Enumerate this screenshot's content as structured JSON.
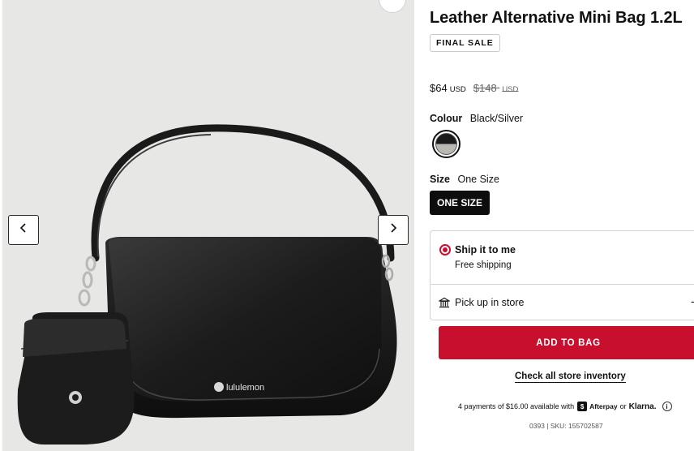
{
  "product": {
    "title": "Leather Alternative Mini Bag 1.2L",
    "badge": "FINAL SALE",
    "brand_logo_text": "lululemon"
  },
  "price": {
    "sale": "$64",
    "sale_currency": "USD",
    "original": "$148",
    "original_currency": "USD"
  },
  "colour": {
    "label": "Colour",
    "value": "Black/Silver"
  },
  "size": {
    "label": "Size",
    "value": "One Size",
    "option": "ONE SIZE"
  },
  "delivery": {
    "ship_title": "Ship it to me",
    "ship_subtitle": "Free shipping",
    "pickup_title": "Pick up in store",
    "pickup_trailing": "-"
  },
  "actions": {
    "add_to_bag": "ADD TO BAG",
    "check_inventory": "Check all store inventory"
  },
  "payments": {
    "installments_text": "4 payments of $16.00 available with",
    "afterpay": "Afterpay",
    "or": "or",
    "klarna": "Klarna."
  },
  "sku_line": "0393 | SKU: 155702587",
  "colors": {
    "accent": "#c8102e",
    "gallery_bg": "#e7e7e6",
    "button_dark": "#0d0d0d"
  },
  "icons": {
    "prev": "chevron-left-icon",
    "next": "chevron-right-icon",
    "store": "store-icon",
    "info": "info-icon"
  }
}
